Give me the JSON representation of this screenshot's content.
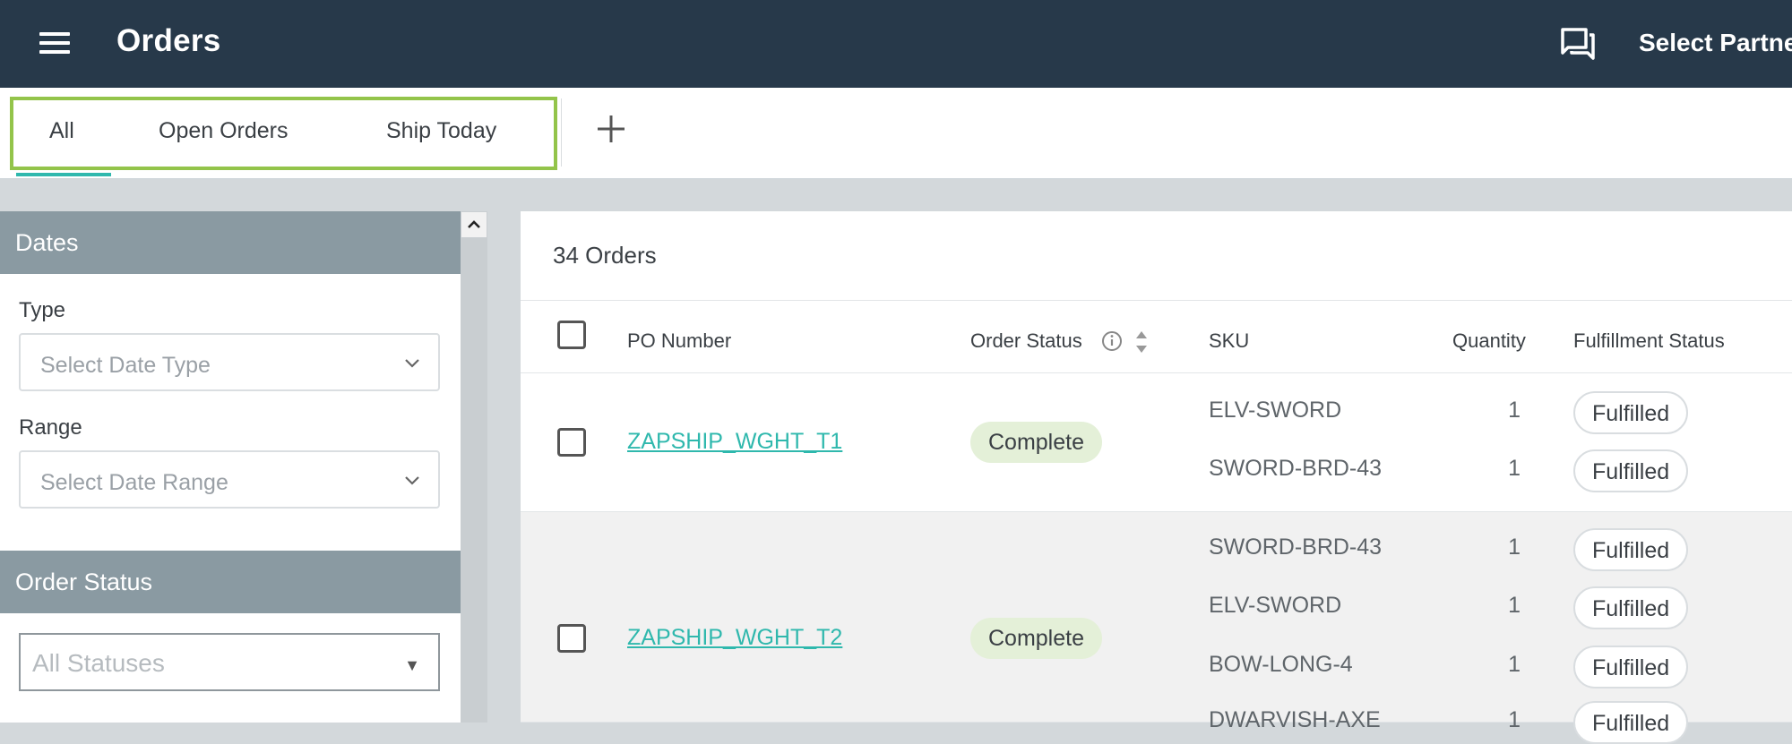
{
  "header": {
    "title": "Orders",
    "partner_select": "Select Partner"
  },
  "tabs": [
    {
      "label": "All",
      "active": true
    },
    {
      "label": "Open Orders",
      "active": false
    },
    {
      "label": "Ship Today",
      "active": false
    }
  ],
  "sidebar": {
    "dates_section": "Dates",
    "type_label": "Type",
    "type_placeholder": "Select Date Type",
    "range_label": "Range",
    "range_placeholder": "Select Date Range",
    "order_status_section": "Order Status",
    "status_placeholder": "All Statuses"
  },
  "main": {
    "order_count": "34 Orders",
    "columns": {
      "po_number": "PO Number",
      "order_status": "Order Status",
      "sku": "SKU",
      "quantity": "Quantity",
      "fulfillment_status": "Fulfillment Status"
    },
    "rows": [
      {
        "po": "ZAPSHIP_WGHT_T1",
        "status": "Complete",
        "items": [
          {
            "sku": "ELV-SWORD",
            "qty": "1",
            "fulfillment": "Fulfilled"
          },
          {
            "sku": "SWORD-BRD-43",
            "qty": "1",
            "fulfillment": "Fulfilled"
          }
        ]
      },
      {
        "po": "ZAPSHIP_WGHT_T2",
        "status": "Complete",
        "items": [
          {
            "sku": "SWORD-BRD-43",
            "qty": "1",
            "fulfillment": "Fulfilled"
          },
          {
            "sku": "ELV-SWORD",
            "qty": "1",
            "fulfillment": "Fulfilled"
          },
          {
            "sku": "BOW-LONG-4",
            "qty": "1",
            "fulfillment": "Fulfilled"
          },
          {
            "sku": "DWARVISH-AXE",
            "qty": "1",
            "fulfillment": "Fulfilled"
          }
        ]
      }
    ]
  },
  "colors": {
    "topbar": "#27394a",
    "accent": "#2fb8ad",
    "tab_highlight": "#93c44a",
    "section_header": "#8a9aa2",
    "status_complete_bg": "#e4f0d8"
  },
  "icons": {
    "menu": "hamburger-icon",
    "chat": "chat-icon",
    "add_tab": "plus-icon",
    "info": "info-icon",
    "sort": "sort-icon",
    "dropdown": "chevron-down-icon",
    "scroll_up": "chevron-up-icon"
  }
}
